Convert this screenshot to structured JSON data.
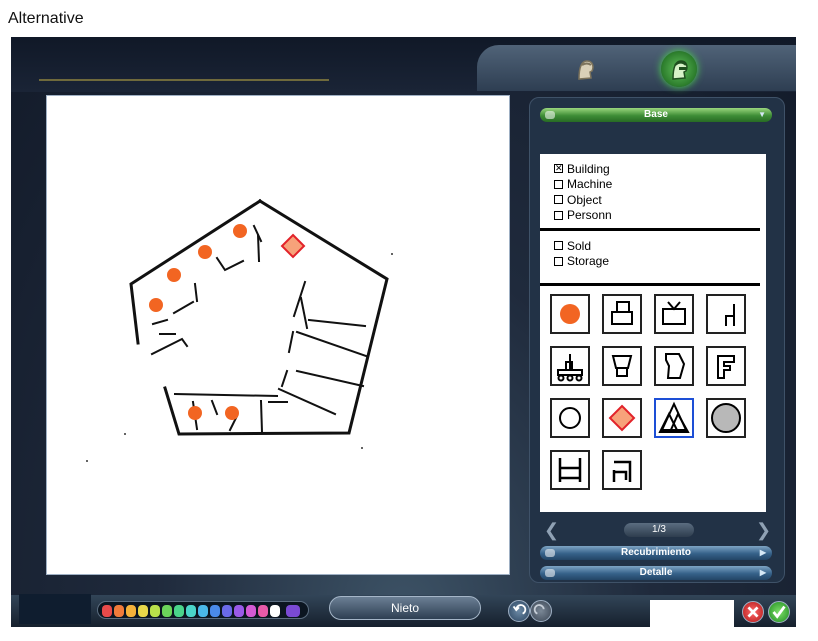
{
  "caption": "Alternative",
  "panel": {
    "category_header": "Base",
    "filters_type": [
      {
        "label": "Building",
        "checked": true
      },
      {
        "label": "Machine",
        "checked": false
      },
      {
        "label": "Object",
        "checked": false
      },
      {
        "label": "Personn",
        "checked": false
      }
    ],
    "filters_state": [
      {
        "label": "Sold",
        "checked": false
      },
      {
        "label": "Storage",
        "checked": false
      }
    ],
    "items": [
      {
        "icon": "orange-circle-icon",
        "selected": false
      },
      {
        "icon": "stacked-boxes-icon",
        "selected": false
      },
      {
        "icon": "tv-icon",
        "selected": false
      },
      {
        "icon": "chair-outline-icon",
        "selected": false
      },
      {
        "icon": "cart-icon",
        "selected": false
      },
      {
        "icon": "lamp-icon",
        "selected": false
      },
      {
        "icon": "trapezoid-icon",
        "selected": false
      },
      {
        "icon": "f-shape-icon",
        "selected": false
      },
      {
        "icon": "circle-outline-icon",
        "selected": false
      },
      {
        "icon": "orange-diamond-icon",
        "selected": false
      },
      {
        "icon": "triangles-icon",
        "selected": true
      },
      {
        "icon": "gray-circle-icon",
        "selected": false
      },
      {
        "icon": "table-icon",
        "selected": false
      },
      {
        "icon": "chair-icon",
        "selected": false
      }
    ],
    "page_indicator": "1/3",
    "section_overlay": "Recubrimiento",
    "section_detail": "Detalle"
  },
  "bottom": {
    "name_value": "Nieto",
    "palette_colors": [
      "#e84a4a",
      "#f07b3a",
      "#f4b23a",
      "#e8d84a",
      "#b8e04a",
      "#6bd45a",
      "#4ad48a",
      "#4ad4c8",
      "#4ab8e8",
      "#4a8ae8",
      "#6a6ae8",
      "#9a5ae8",
      "#d45ad4",
      "#e85aa8",
      "#ffffff",
      "#7a4ad4"
    ]
  },
  "colors": {
    "accent_green": "#3d8d36",
    "accent_blue": "#356189",
    "furniture_orange": "#f26522"
  }
}
